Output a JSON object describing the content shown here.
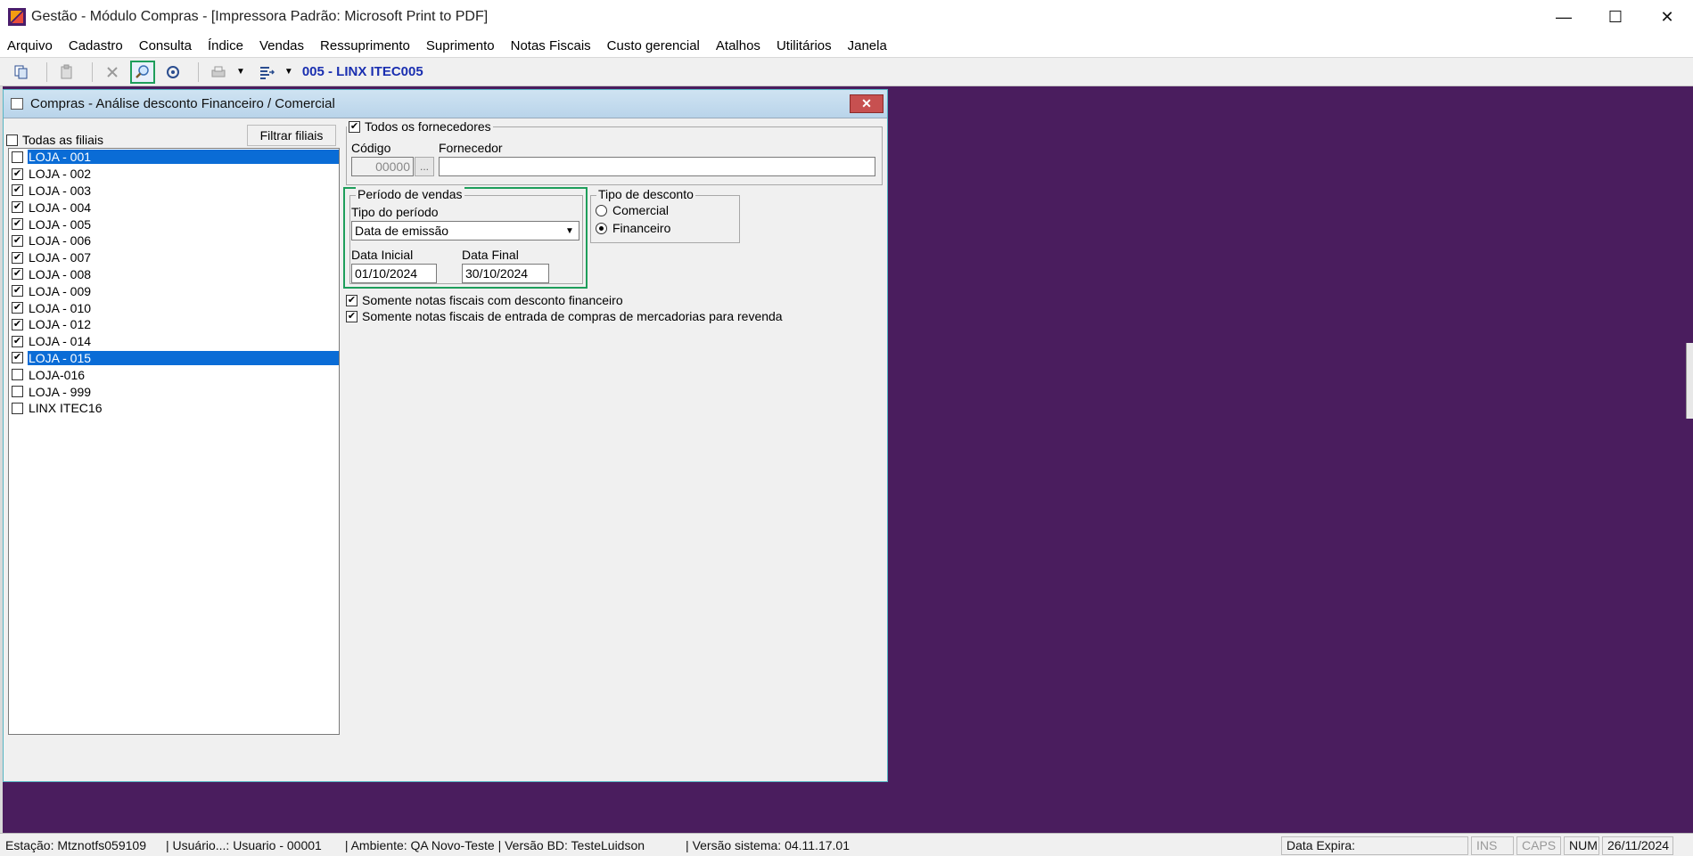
{
  "window": {
    "title": "Gestão  - Módulo Compras - [Impressora Padrão: Microsoft Print to PDF]",
    "minimize": "—",
    "maximize": "☐",
    "close": "✕"
  },
  "menu": [
    "Arquivo",
    "Cadastro",
    "Consulta",
    "Índice",
    "Vendas",
    "Ressuprimento",
    "Suprimento",
    "Notas Fiscais",
    "Custo gerencial",
    "Atalhos",
    "Utilitários",
    "Janela"
  ],
  "toolbar": {
    "company_label": "005 - LINX ITEC005",
    "icons": [
      "copy-icon",
      "paste-icon",
      "delete-icon",
      "search-icon",
      "target-icon",
      "print-icon",
      "export-icon"
    ]
  },
  "child_window": {
    "title": "Compras - Análise desconto Financeiro / Comercial",
    "close": "✕"
  },
  "stores": {
    "all_label": "Todas as filiais",
    "all_checked": false,
    "filter_button": "Filtrar filiais",
    "items": [
      {
        "label": "LOJA - 001",
        "checked": false,
        "selected": true
      },
      {
        "label": "LOJA - 002",
        "checked": true,
        "selected": false
      },
      {
        "label": "LOJA - 003",
        "checked": true,
        "selected": false
      },
      {
        "label": "LOJA - 004",
        "checked": true,
        "selected": false
      },
      {
        "label": "LOJA - 005",
        "checked": true,
        "selected": false
      },
      {
        "label": "LOJA - 006",
        "checked": true,
        "selected": false
      },
      {
        "label": "LOJA - 007",
        "checked": true,
        "selected": false
      },
      {
        "label": "LOJA - 008",
        "checked": true,
        "selected": false
      },
      {
        "label": "LOJA - 009",
        "checked": true,
        "selected": false
      },
      {
        "label": "LOJA - 010",
        "checked": true,
        "selected": false
      },
      {
        "label": "LOJA - 012",
        "checked": true,
        "selected": false
      },
      {
        "label": "LOJA - 014",
        "checked": true,
        "selected": false
      },
      {
        "label": "LOJA - 015",
        "checked": true,
        "selected": true
      },
      {
        "label": "LOJA-016",
        "checked": false,
        "selected": false
      },
      {
        "label": "LOJA - 999",
        "checked": false,
        "selected": false
      },
      {
        "label": "LINX ITEC16",
        "checked": false,
        "selected": false
      }
    ]
  },
  "suppliers": {
    "all_label": "Todos os fornecedores",
    "all_checked": true,
    "code_label": "Código",
    "code_value": "00000",
    "code_button": "...",
    "supplier_label": "Fornecedor",
    "supplier_value": ""
  },
  "period": {
    "group_label": "Período de vendas",
    "type_label": "Tipo do período",
    "type_value": "Data de emissão",
    "start_label": "Data Inicial",
    "start_value": "01/10/2024",
    "end_label": "Data Final",
    "end_value": "30/10/2024"
  },
  "discount_type": {
    "group_label": "Tipo de desconto",
    "options": [
      {
        "label": "Comercial",
        "selected": false
      },
      {
        "label": "Financeiro",
        "selected": true
      }
    ]
  },
  "options": [
    {
      "label": "Somente notas fiscais com desconto financeiro",
      "checked": true
    },
    {
      "label": "Somente notas fiscais de entrada de compras de mercadorias para revenda",
      "checked": true
    }
  ],
  "statusbar": {
    "station": "Estação: Mtznotfs059109",
    "user": "| Usuário...: Usuario - 00001",
    "environment": "| Ambiente: QA Novo-Teste | Versão BD: TesteLuidson",
    "version": "| Versão sistema: 04.11.17.01",
    "expires": "Data Expira:",
    "ins": "INS",
    "caps": "CAPS",
    "num": "NUM",
    "date": "26/11/2024"
  },
  "colors": {
    "mdi_background": "#4a1d5e",
    "selection": "#0a6cd6",
    "highlight": "#1e9e5b",
    "company_label": "#1a2fb0"
  }
}
